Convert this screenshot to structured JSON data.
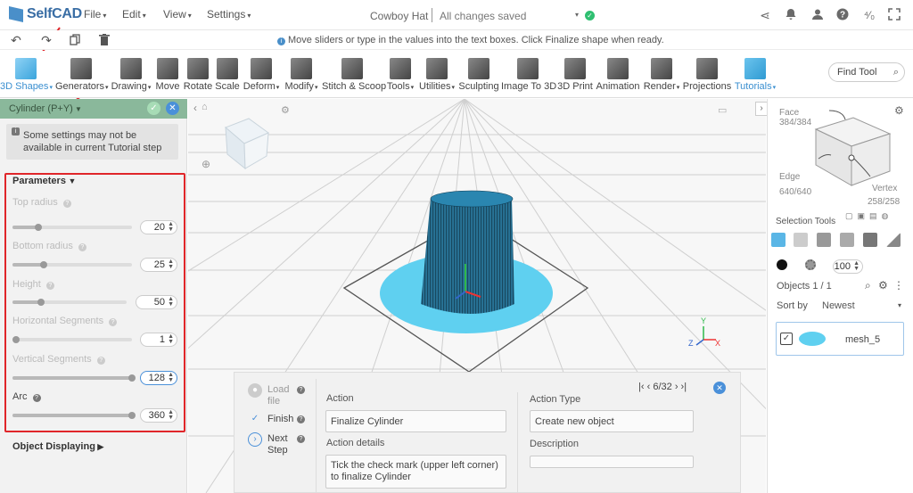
{
  "app": {
    "logo": "SelfCAD"
  },
  "menu": {
    "file": "File",
    "edit": "Edit",
    "view": "View",
    "settings": "Settings"
  },
  "document": {
    "title": "Cowboy Hat",
    "status": "All changes saved"
  },
  "hint": "Move sliders or type in the values into the text boxes. Click Finalize shape when ready.",
  "toolbar": {
    "tools": [
      "3D Shapes",
      "Generators",
      "Drawing",
      "Move",
      "Rotate",
      "Scale",
      "Deform",
      "Modify",
      "Stitch & Scoop",
      "Tools",
      "Utilities",
      "Sculpting",
      "Image To 3D",
      "3D Print",
      "Animation",
      "Render",
      "Projections",
      "Tutorials"
    ],
    "find_placeholder": "Find Tool"
  },
  "panel": {
    "title": "Cylinder (P+Y)",
    "warning": "Some settings may not be available in current Tutorial step",
    "params_title": "Parameters",
    "params": [
      {
        "label": "Top radius",
        "value": "20",
        "level": 0.22
      },
      {
        "label": "Bottom radius",
        "value": "25",
        "level": 0.26
      },
      {
        "label": "Height",
        "value": "50",
        "level": 0.25
      },
      {
        "label": "Horizontal Segments",
        "value": "1",
        "level": 0.0
      },
      {
        "label": "Vertical Segments",
        "value": "128",
        "level": 1.0
      },
      {
        "label": "Arc",
        "value": "360",
        "level": 1.0
      }
    ],
    "object_displaying": "Object Displaying"
  },
  "tutorial": {
    "steps": {
      "load": "Load file",
      "finish": "Finish",
      "next": "Next Step"
    },
    "action_label": "Action",
    "action_value": "Finalize Cylinder",
    "details_label": "Action details",
    "details_value": "Tick the check mark (upper left corner) to finalize Cylinder",
    "type_label": "Action Type",
    "type_value": "Create new object",
    "description_label": "Description",
    "nav": "6/32"
  },
  "right": {
    "face_label": "Face",
    "face_count": "384/384",
    "edge_label": "Edge",
    "edge_count": "640/640",
    "vertex_label": "Vertex",
    "vertex_count": "258/258",
    "selection_tools": "Selection Tools",
    "brush_size": "100",
    "objects": "Objects 1 / 1",
    "sort_label": "Sort by",
    "sort_value": "Newest",
    "object_name": "mesh_5"
  },
  "axes": {
    "x": "X",
    "y": "Y",
    "z": "Z"
  },
  "colors": {
    "accent": "#4a90d9",
    "panel_header": "#8ab89b",
    "highlight": "#e0262a",
    "mesh": "#2e7fa8",
    "base": "#5fd0f0"
  }
}
